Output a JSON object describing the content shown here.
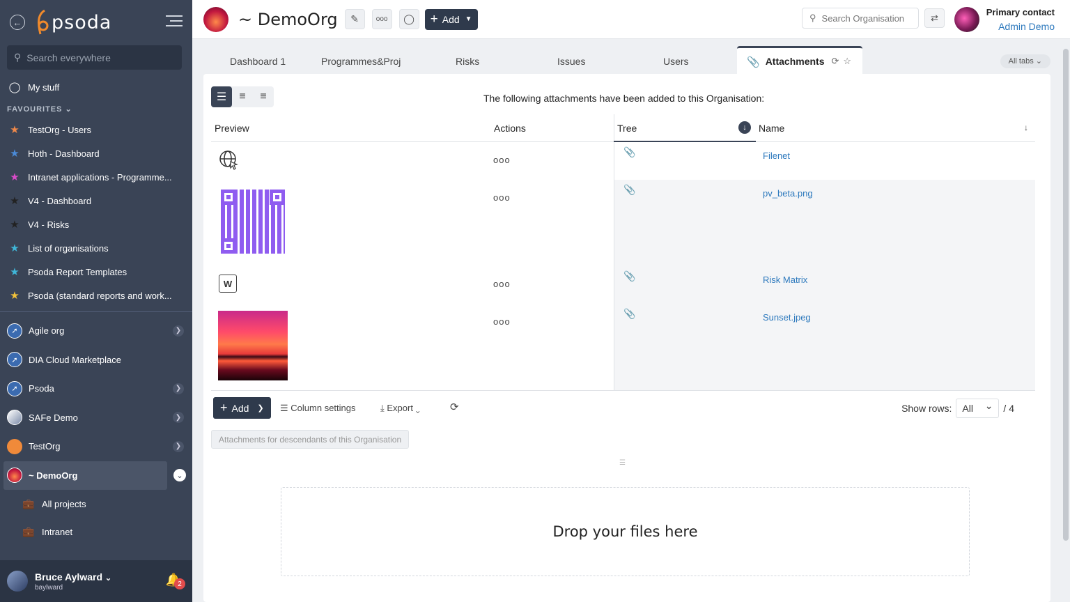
{
  "app": {
    "brand": "psoda"
  },
  "sidebar": {
    "search_placeholder": "Search everywhere",
    "my_stuff": "My stuff",
    "favourites_header": "FAVOURITES",
    "favourites": [
      {
        "label": "TestOrg - Users",
        "star_color": "#f0894a"
      },
      {
        "label": "Hoth - Dashboard",
        "star_color": "#4b8bd8"
      },
      {
        "label": "Intranet applications - Programme...",
        "star_color": "#d94bc9"
      },
      {
        "label": "V4 - Dashboard",
        "star_color": "#222222"
      },
      {
        "label": "V4 - Risks",
        "star_color": "#222222"
      },
      {
        "label": "List of organisations",
        "star_color": "#3fb6d8"
      },
      {
        "label": "Psoda Report Templates",
        "star_color": "#3fb6d8"
      },
      {
        "label": "Psoda (standard reports and work...",
        "star_color": "#f2c23a"
      }
    ],
    "orgs": [
      {
        "label": "Agile org"
      },
      {
        "label": "DIA Cloud Marketplace"
      },
      {
        "label": "Psoda"
      },
      {
        "label": "SAFe Demo"
      },
      {
        "label": "TestOrg"
      },
      {
        "label": "~ DemoOrg"
      }
    ],
    "subitems": [
      {
        "label": "All projects"
      },
      {
        "label": "Intranet"
      }
    ],
    "user": {
      "name": "Bruce Aylward",
      "username": "baylward",
      "notifications": "2"
    }
  },
  "header": {
    "org_title": "~ DemoOrg",
    "add_label": "Add",
    "search_placeholder": "Search Organisation",
    "primary_contact_label": "Primary contact",
    "primary_contact_name": "Admin Demo"
  },
  "tabs": [
    {
      "label": "Dashboard 1"
    },
    {
      "label": "Programmes&Proj"
    },
    {
      "label": "Risks"
    },
    {
      "label": "Issues"
    },
    {
      "label": "Users"
    },
    {
      "label": "Attachments"
    }
  ],
  "all_tabs_label": "All tabs",
  "main": {
    "intro": "The following attachments have been added to this Organisation:",
    "columns": {
      "preview": "Preview",
      "actions": "Actions",
      "tree": "Tree",
      "name": "Name"
    },
    "rows": [
      {
        "name": "Filenet",
        "preview": "globe-link-icon",
        "actions": "ooo"
      },
      {
        "name": "pv_beta.png",
        "preview": "qr-code-image",
        "actions": "ooo"
      },
      {
        "name": "Risk Matrix",
        "preview": "word-document-icon",
        "actions": "ooo"
      },
      {
        "name": "Sunset.jpeg",
        "preview": "sunset-image",
        "actions": "ooo"
      }
    ],
    "footer": {
      "add_label": "Add",
      "column_settings": "Column settings",
      "export": "Export",
      "show_rows_label": "Show rows:",
      "show_rows_value": "All",
      "total": "/ 4"
    },
    "descendants_label": "Attachments for descendants of this Organisation",
    "drop_label": "Drop your files here"
  }
}
